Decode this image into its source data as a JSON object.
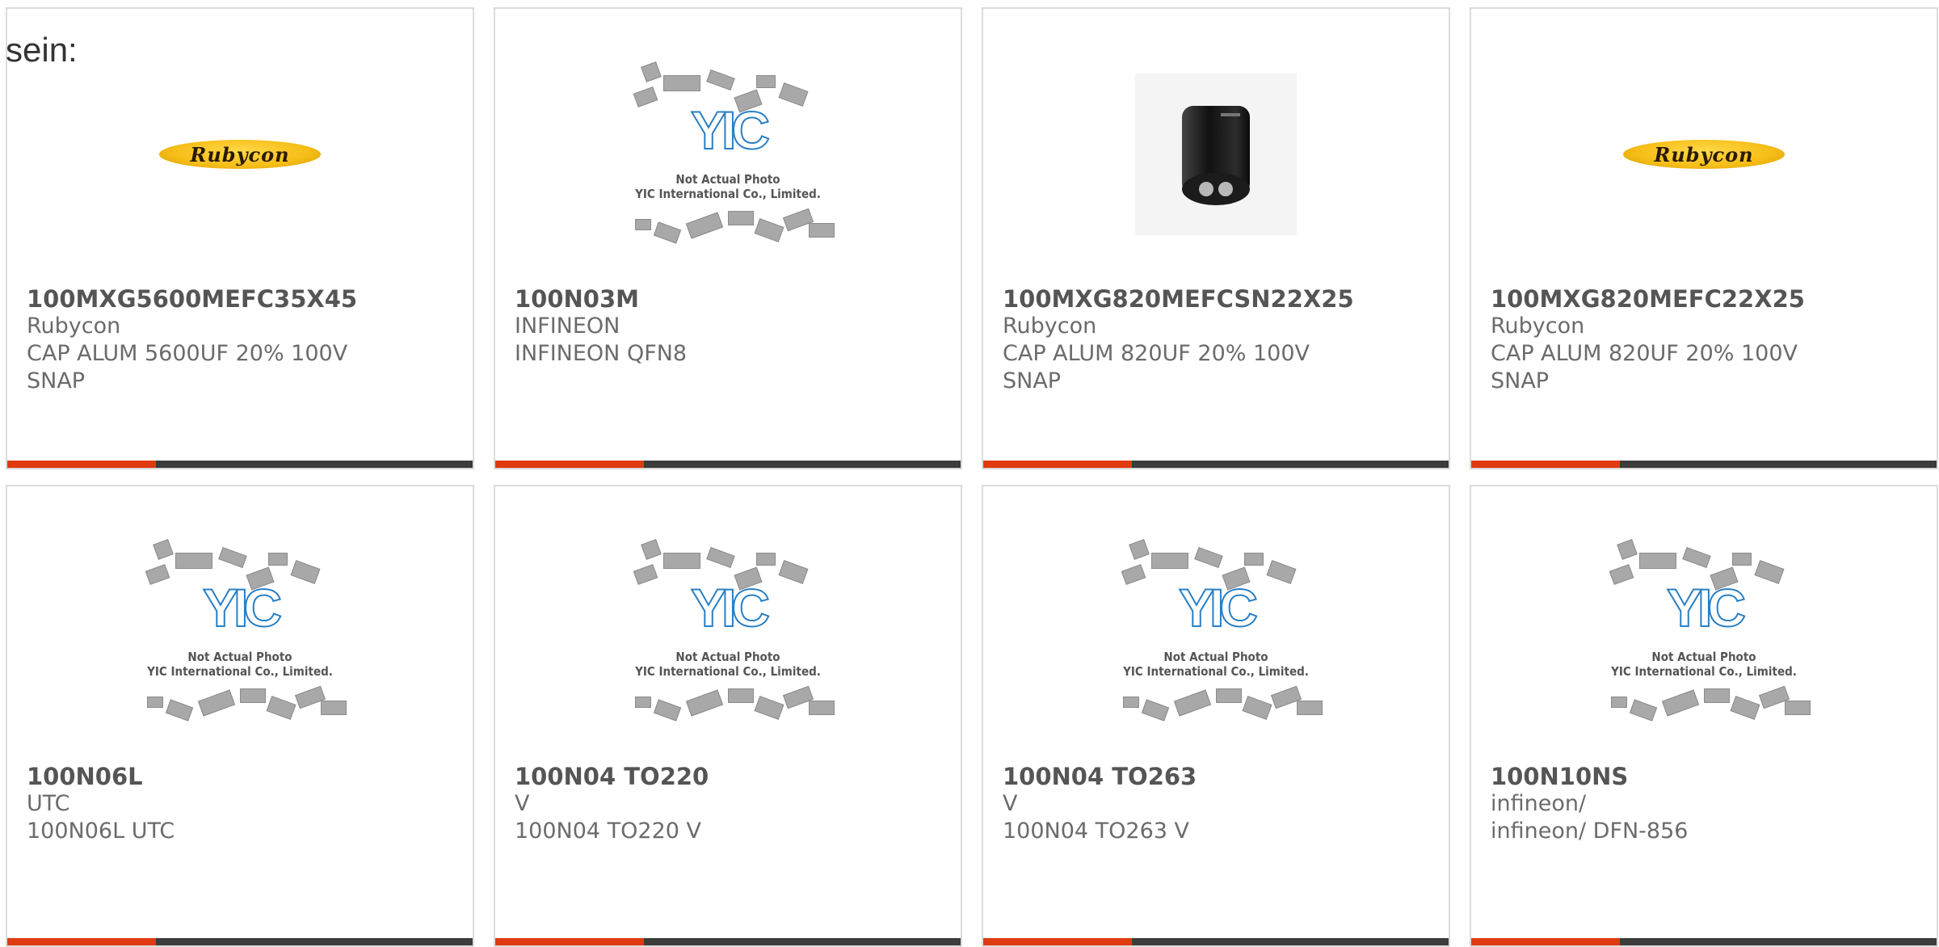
{
  "intro_text": "sein:",
  "placeholder": {
    "line1": "Not Actual Photo",
    "line2": "YIC International Co., Limited.",
    "logo": "YIC"
  },
  "brand_logo_text": "Rubycon",
  "colors": {
    "accent": "#e03a10",
    "bar": "#3c3c3c",
    "border": "#dcdcdc"
  },
  "products": [
    {
      "part": "100MXG5600MEFC35X45",
      "maker": "Rubycon",
      "desc": "CAP ALUM 5600UF 20% 100V",
      "desc2": "SNAP",
      "image": "rubycon-logo"
    },
    {
      "part": "100N03M",
      "maker": "INFINEON",
      "desc": "INFINEON QFN8",
      "desc2": "",
      "image": "yic-placeholder"
    },
    {
      "part": "100MXG820MEFCSN22X25",
      "maker": "Rubycon",
      "desc": "CAP ALUM 820UF 20% 100V",
      "desc2": "SNAP",
      "image": "capacitor-photo"
    },
    {
      "part": "100MXG820MEFC22X25",
      "maker": "Rubycon",
      "desc": "CAP ALUM 820UF 20% 100V",
      "desc2": "SNAP",
      "image": "rubycon-logo"
    },
    {
      "part": "100N06L",
      "maker": "UTC",
      "desc": "100N06L UTC",
      "desc2": "",
      "image": "yic-placeholder"
    },
    {
      "part": "100N04 TO220",
      "maker": "V",
      "desc": "100N04 TO220 V",
      "desc2": "",
      "image": "yic-placeholder"
    },
    {
      "part": "100N04 TO263",
      "maker": "V",
      "desc": "100N04 TO263 V",
      "desc2": "",
      "image": "yic-placeholder"
    },
    {
      "part": "100N10NS",
      "maker": "infineon/",
      "desc": "infineon/ DFN-856",
      "desc2": "",
      "image": "yic-placeholder"
    }
  ]
}
